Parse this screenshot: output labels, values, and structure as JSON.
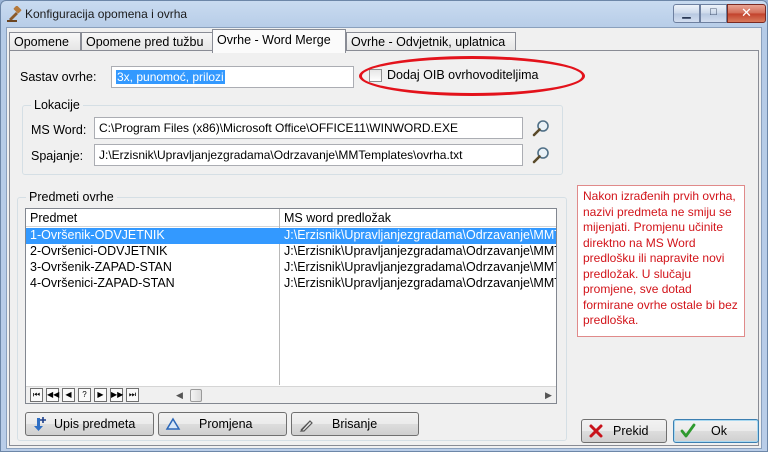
{
  "window": {
    "title": "Konfiguracija opomena i ovrha",
    "minimize_glyph": "▁",
    "maximize_glyph": "□",
    "close_glyph": "✕"
  },
  "tabs": [
    {
      "label": "Opomene",
      "active": false
    },
    {
      "label": "Opomene pred tužbu",
      "active": false
    },
    {
      "label": "Ovrhe - Word Merge",
      "active": true
    },
    {
      "label": "Ovrhe - Odvjetnik, uplatnica",
      "active": false
    }
  ],
  "sastav": {
    "label": "Sastav ovrhe:",
    "value": "3x, punomoć, prilozi"
  },
  "oib_checkbox": {
    "label": "Dodaj OIB ovrhovoditeljima",
    "checked": false
  },
  "lokacije": {
    "title": "Lokacije",
    "ms_word_label": "MS Word:",
    "ms_word_value": "C:\\Program Files (x86)\\Microsoft Office\\OFFICE11\\WINWORD.EXE",
    "spajanje_label": "Spajanje:",
    "spajanje_value": "J:\\Erzisnik\\Upravljanjezgradama\\Odrzavanje\\MMTemplates\\ovrha.txt"
  },
  "predmeti": {
    "title": "Predmeti ovrhe",
    "columns": [
      "Predmet",
      "MS word predložak"
    ],
    "rows": [
      {
        "predmet": "1-Ovršenik-ODVJETNIK",
        "predlozak": "J:\\Erzisnik\\Upravljanjezgradama\\Odrzavanje\\MMTemplates",
        "selected": true
      },
      {
        "predmet": "2-Ovršenici-ODVJETNIK",
        "predlozak": "J:\\Erzisnik\\Upravljanjezgradama\\Odrzavanje\\MMTemplates",
        "selected": false
      },
      {
        "predmet": "3-Ovršenik-ZAPAD-STAN",
        "predlozak": "J:\\Erzisnik\\Upravljanjezgradama\\Odrzavanje\\MMTemplates",
        "selected": false
      },
      {
        "predmet": "4-Ovršenici-ZAPAD-STAN",
        "predlozak": "J:\\Erzisnik\\Upravljanjezgradama\\Odrzavanje\\MMTemplates",
        "selected": false
      }
    ],
    "nav_buttons": [
      "⏮",
      "◀◀",
      "◀",
      "?",
      "▶",
      "▶▶",
      "⏭"
    ]
  },
  "buttons": {
    "upis": "Upis predmeta",
    "promjena": "Promjena",
    "brisanje": "Brisanje",
    "prekid": "Prekid",
    "ok": "Ok"
  },
  "note_text": "Nakon izrađenih prvih ovrha, nazivi predmeta ne smiju se mijenjati. Promjenu učinite direktno na MS Word predlošku ili napravite novi predložak. U slučaju promjene, sve dotad formirane ovrhe ostale bi bez predloška.",
  "colors": {
    "selection": "#3399ff",
    "highlight_ellipse": "#e3121b",
    "note_text": "#d2141a"
  }
}
